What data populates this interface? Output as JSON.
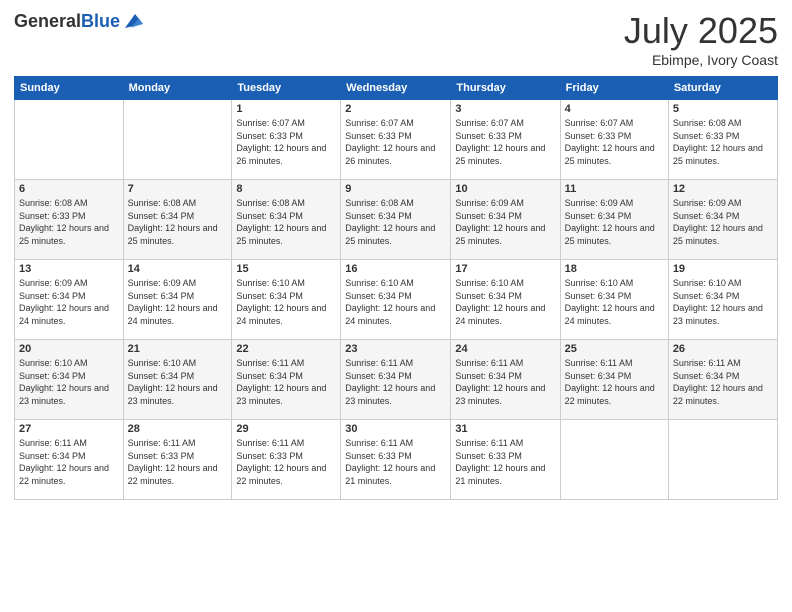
{
  "header": {
    "logo_general": "General",
    "logo_blue": "Blue",
    "month_title": "July 2025",
    "subtitle": "Ebimpe, Ivory Coast"
  },
  "days_of_week": [
    "Sunday",
    "Monday",
    "Tuesday",
    "Wednesday",
    "Thursday",
    "Friday",
    "Saturday"
  ],
  "weeks": [
    [
      {
        "day": "",
        "info": ""
      },
      {
        "day": "",
        "info": ""
      },
      {
        "day": "1",
        "info": "Sunrise: 6:07 AM\nSunset: 6:33 PM\nDaylight: 12 hours and 26 minutes."
      },
      {
        "day": "2",
        "info": "Sunrise: 6:07 AM\nSunset: 6:33 PM\nDaylight: 12 hours and 26 minutes."
      },
      {
        "day": "3",
        "info": "Sunrise: 6:07 AM\nSunset: 6:33 PM\nDaylight: 12 hours and 25 minutes."
      },
      {
        "day": "4",
        "info": "Sunrise: 6:07 AM\nSunset: 6:33 PM\nDaylight: 12 hours and 25 minutes."
      },
      {
        "day": "5",
        "info": "Sunrise: 6:08 AM\nSunset: 6:33 PM\nDaylight: 12 hours and 25 minutes."
      }
    ],
    [
      {
        "day": "6",
        "info": "Sunrise: 6:08 AM\nSunset: 6:33 PM\nDaylight: 12 hours and 25 minutes."
      },
      {
        "day": "7",
        "info": "Sunrise: 6:08 AM\nSunset: 6:34 PM\nDaylight: 12 hours and 25 minutes."
      },
      {
        "day": "8",
        "info": "Sunrise: 6:08 AM\nSunset: 6:34 PM\nDaylight: 12 hours and 25 minutes."
      },
      {
        "day": "9",
        "info": "Sunrise: 6:08 AM\nSunset: 6:34 PM\nDaylight: 12 hours and 25 minutes."
      },
      {
        "day": "10",
        "info": "Sunrise: 6:09 AM\nSunset: 6:34 PM\nDaylight: 12 hours and 25 minutes."
      },
      {
        "day": "11",
        "info": "Sunrise: 6:09 AM\nSunset: 6:34 PM\nDaylight: 12 hours and 25 minutes."
      },
      {
        "day": "12",
        "info": "Sunrise: 6:09 AM\nSunset: 6:34 PM\nDaylight: 12 hours and 25 minutes."
      }
    ],
    [
      {
        "day": "13",
        "info": "Sunrise: 6:09 AM\nSunset: 6:34 PM\nDaylight: 12 hours and 24 minutes."
      },
      {
        "day": "14",
        "info": "Sunrise: 6:09 AM\nSunset: 6:34 PM\nDaylight: 12 hours and 24 minutes."
      },
      {
        "day": "15",
        "info": "Sunrise: 6:10 AM\nSunset: 6:34 PM\nDaylight: 12 hours and 24 minutes."
      },
      {
        "day": "16",
        "info": "Sunrise: 6:10 AM\nSunset: 6:34 PM\nDaylight: 12 hours and 24 minutes."
      },
      {
        "day": "17",
        "info": "Sunrise: 6:10 AM\nSunset: 6:34 PM\nDaylight: 12 hours and 24 minutes."
      },
      {
        "day": "18",
        "info": "Sunrise: 6:10 AM\nSunset: 6:34 PM\nDaylight: 12 hours and 24 minutes."
      },
      {
        "day": "19",
        "info": "Sunrise: 6:10 AM\nSunset: 6:34 PM\nDaylight: 12 hours and 23 minutes."
      }
    ],
    [
      {
        "day": "20",
        "info": "Sunrise: 6:10 AM\nSunset: 6:34 PM\nDaylight: 12 hours and 23 minutes."
      },
      {
        "day": "21",
        "info": "Sunrise: 6:10 AM\nSunset: 6:34 PM\nDaylight: 12 hours and 23 minutes."
      },
      {
        "day": "22",
        "info": "Sunrise: 6:11 AM\nSunset: 6:34 PM\nDaylight: 12 hours and 23 minutes."
      },
      {
        "day": "23",
        "info": "Sunrise: 6:11 AM\nSunset: 6:34 PM\nDaylight: 12 hours and 23 minutes."
      },
      {
        "day": "24",
        "info": "Sunrise: 6:11 AM\nSunset: 6:34 PM\nDaylight: 12 hours and 23 minutes."
      },
      {
        "day": "25",
        "info": "Sunrise: 6:11 AM\nSunset: 6:34 PM\nDaylight: 12 hours and 22 minutes."
      },
      {
        "day": "26",
        "info": "Sunrise: 6:11 AM\nSunset: 6:34 PM\nDaylight: 12 hours and 22 minutes."
      }
    ],
    [
      {
        "day": "27",
        "info": "Sunrise: 6:11 AM\nSunset: 6:34 PM\nDaylight: 12 hours and 22 minutes."
      },
      {
        "day": "28",
        "info": "Sunrise: 6:11 AM\nSunset: 6:33 PM\nDaylight: 12 hours and 22 minutes."
      },
      {
        "day": "29",
        "info": "Sunrise: 6:11 AM\nSunset: 6:33 PM\nDaylight: 12 hours and 22 minutes."
      },
      {
        "day": "30",
        "info": "Sunrise: 6:11 AM\nSunset: 6:33 PM\nDaylight: 12 hours and 21 minutes."
      },
      {
        "day": "31",
        "info": "Sunrise: 6:11 AM\nSunset: 6:33 PM\nDaylight: 12 hours and 21 minutes."
      },
      {
        "day": "",
        "info": ""
      },
      {
        "day": "",
        "info": ""
      }
    ]
  ]
}
